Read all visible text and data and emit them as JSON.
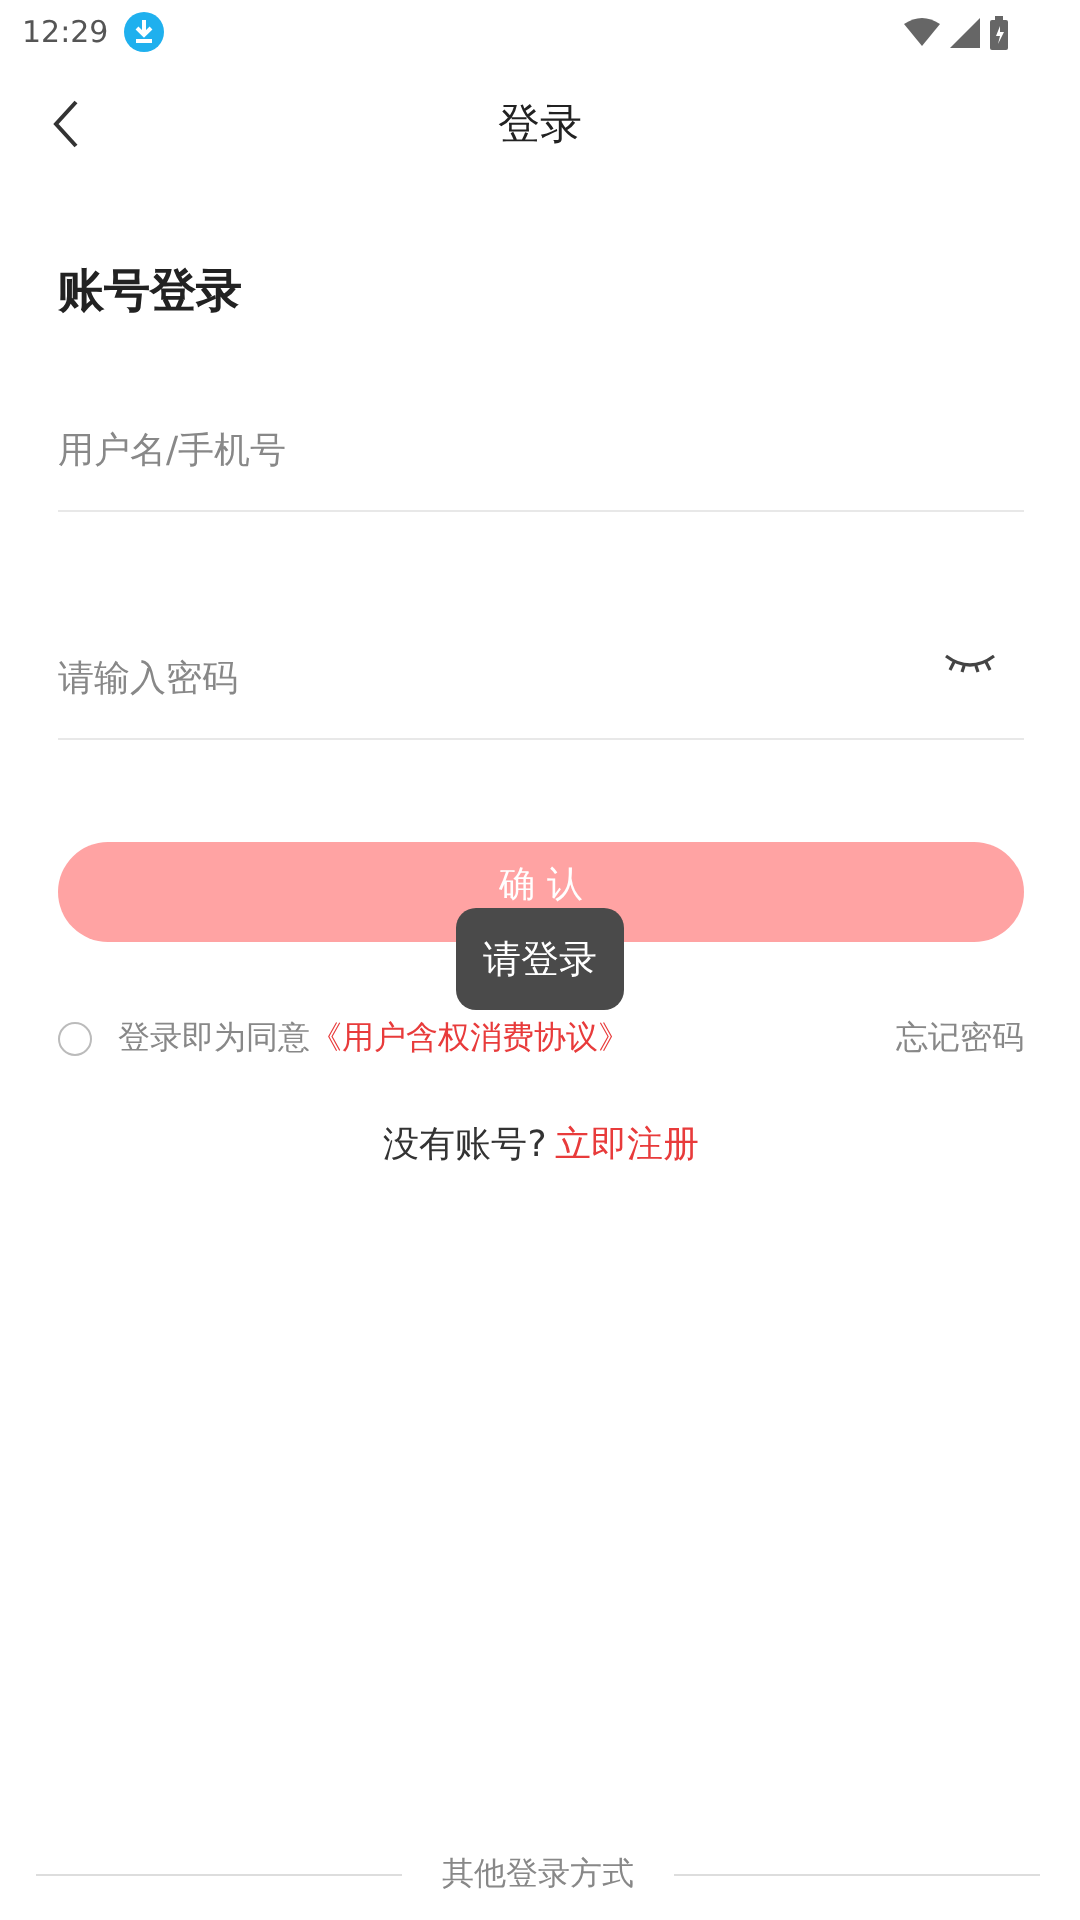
{
  "status_bar": {
    "time": "12:29"
  },
  "header": {
    "title": "登录"
  },
  "heading": "账号登录",
  "fields": [
    {
      "kind": "text",
      "placeholder": "用户名/手机号"
    },
    {
      "kind": "password",
      "placeholder": "请输入密码"
    }
  ],
  "confirm_button": {
    "label": "确 认"
  },
  "toast": "请登录",
  "agreement": {
    "checked": false,
    "text": "登录即为同意",
    "link": "《用户含权消费协议》"
  },
  "forgot_password": "忘记密码",
  "register": {
    "text": "没有账号?",
    "link": "立即注册"
  },
  "other_login": "其他登录方式"
}
